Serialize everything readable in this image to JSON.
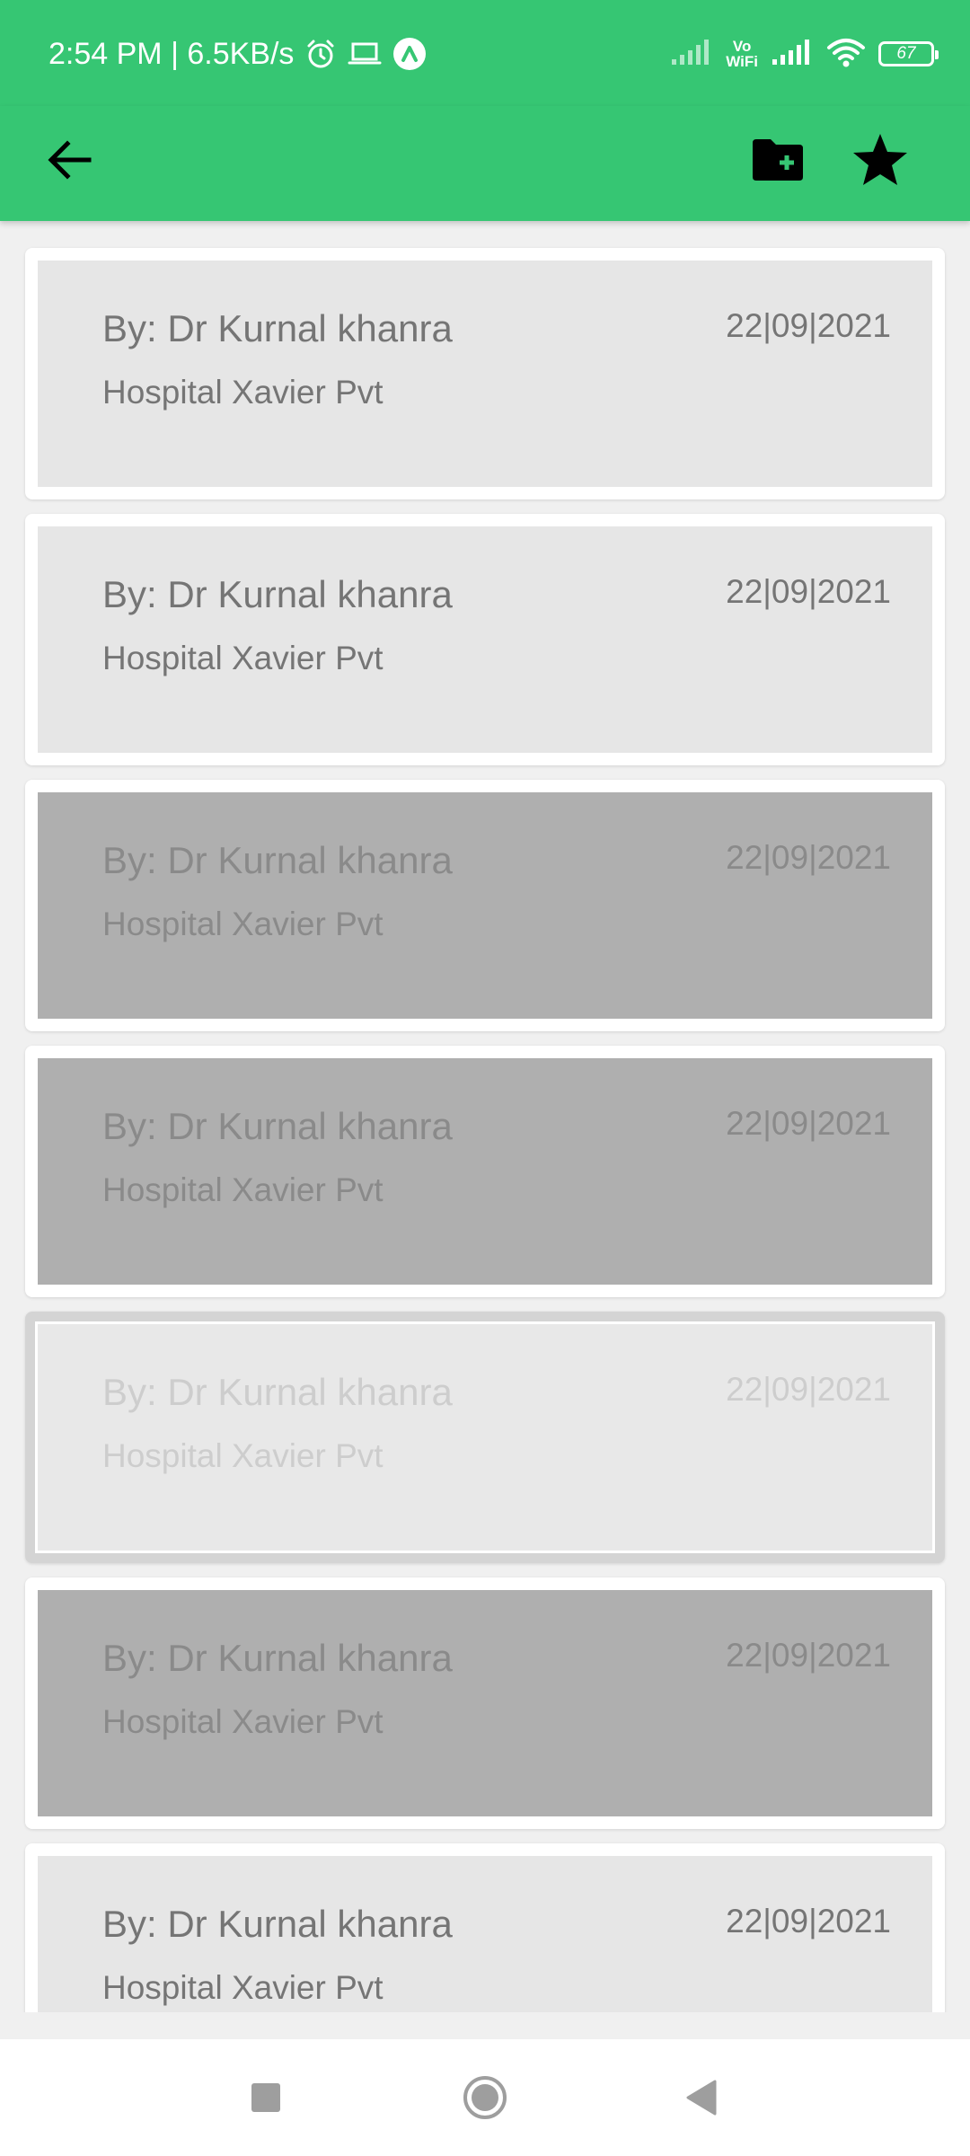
{
  "status_bar": {
    "time_speed": "2:54 PM | 6.5KB/s",
    "vo_top": "Vo",
    "vo_bottom": "WiFi",
    "battery": "67",
    "icons": [
      "alarm-icon",
      "laptop-icon",
      "app-a-icon",
      "signal-icon",
      "signal-icon",
      "wifi-icon",
      "battery-icon"
    ]
  },
  "app_bar": {
    "icons": [
      "back-arrow-icon",
      "folder-add-icon",
      "star-icon"
    ],
    "background": "#36c673"
  },
  "records": [
    {
      "doctor": "By:  Dr Kurnal khanra",
      "hospital": "Hospital Xavier Pvt",
      "date": "22|09|2021",
      "state": "normal"
    },
    {
      "doctor": "By:  Dr Kurnal khanra",
      "hospital": "Hospital Xavier Pvt",
      "date": "22|09|2021",
      "state": "normal"
    },
    {
      "doctor": "By:  Dr Kurnal khanra",
      "hospital": "Hospital Xavier Pvt",
      "date": "22|09|2021",
      "state": "selected"
    },
    {
      "doctor": "By:  Dr Kurnal khanra",
      "hospital": "Hospital Xavier Pvt",
      "date": "22|09|2021",
      "state": "selected"
    },
    {
      "doctor": "By:  Dr Kurnal khanra",
      "hospital": "Hospital Xavier Pvt",
      "date": "22|09|2021",
      "state": "faded"
    },
    {
      "doctor": "By:  Dr Kurnal khanra",
      "hospital": "Hospital Xavier Pvt",
      "date": "22|09|2021",
      "state": "selected"
    },
    {
      "doctor": "By:  Dr Kurnal khanra",
      "hospital": "Hospital Xavier Pvt",
      "date": "22|09|2021",
      "state": "normal"
    }
  ],
  "nav_bar": {
    "icons": [
      "recents-square-icon",
      "home-circle-icon",
      "back-triangle-icon"
    ]
  }
}
